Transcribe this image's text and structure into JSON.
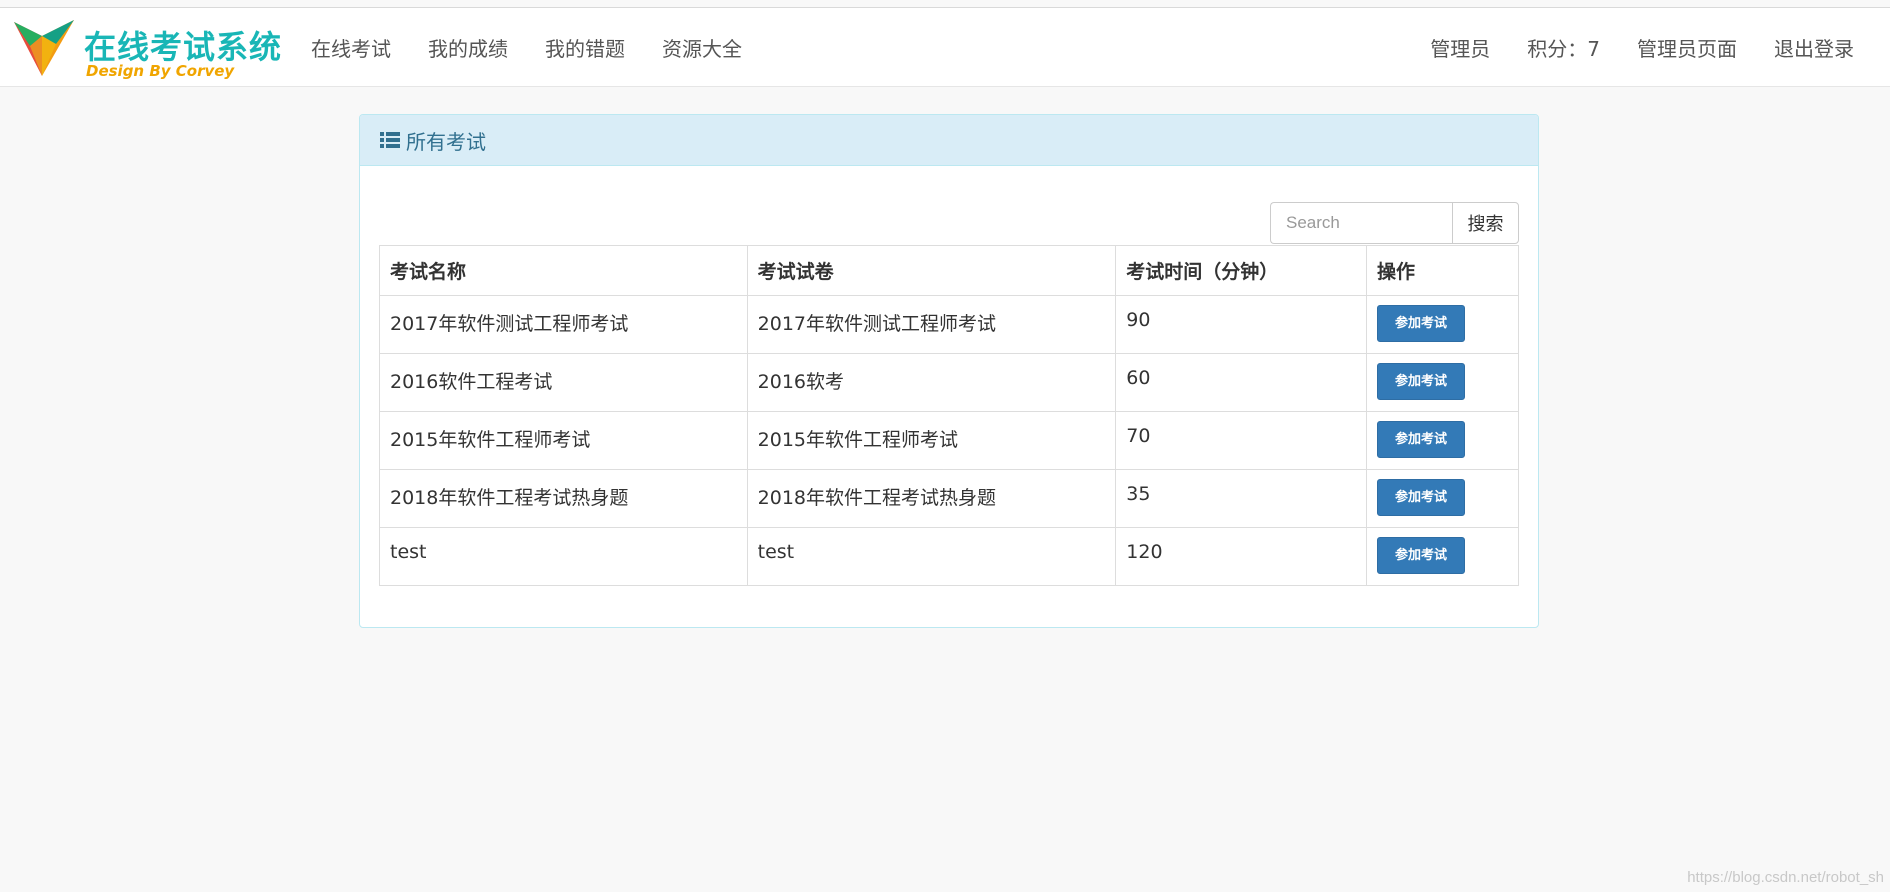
{
  "header": {
    "brand_title": "在线考试系统",
    "brand_subtitle": "Design By Corvey",
    "nav_left": [
      "在线考试",
      "我的成绩",
      "我的错题",
      "资源大全"
    ],
    "user_role": "管理员",
    "points_label": "积分：7",
    "admin_page_link": "管理员页面",
    "logout_link": "退出登录"
  },
  "panel": {
    "title": "所有考试",
    "icon": "list-icon"
  },
  "search": {
    "placeholder": "Search",
    "button_label": "搜索"
  },
  "table": {
    "columns": [
      "考试名称",
      "考试试卷",
      "考试时间（分钟）",
      "操作"
    ],
    "rows": [
      {
        "name": "2017年软件测试工程师考试",
        "paper": "2017年软件测试工程师考试",
        "duration": "90",
        "action": "参加考试"
      },
      {
        "name": "2016软件工程考试",
        "paper": "2016软考",
        "duration": "60",
        "action": "参加考试"
      },
      {
        "name": "2015年软件工程师考试",
        "paper": "2015年软件工程师考试",
        "duration": "70",
        "action": "参加考试"
      },
      {
        "name": "2018年软件工程考试热身题",
        "paper": "2018年软件工程考试热身题",
        "duration": "35",
        "action": "参加考试"
      },
      {
        "name": "test",
        "paper": "test",
        "duration": "120",
        "action": "参加考试"
      }
    ]
  },
  "watermark": "https://blog.csdn.net/robot_sh",
  "colors": {
    "brand": "#19b6b6",
    "brand_sub": "#f0a500",
    "panel_heading_bg": "#d9edf7",
    "panel_heading_text": "#31708f",
    "primary_button": "#337ab7"
  }
}
